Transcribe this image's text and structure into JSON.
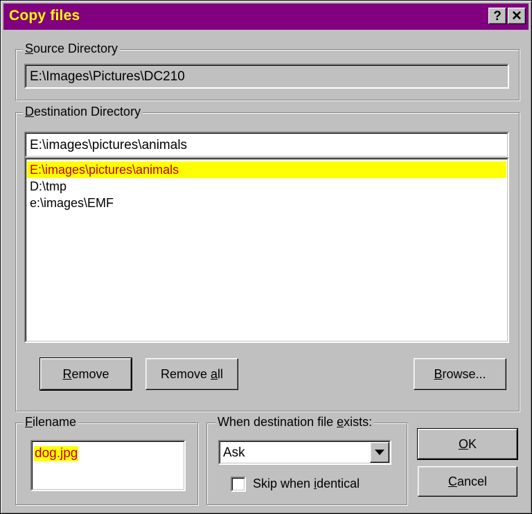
{
  "window": {
    "title": "Copy files",
    "help_label": "?",
    "close_label": "✕"
  },
  "source": {
    "group_label_accel": "S",
    "group_label_rest": "ource Directory",
    "path": "E:\\Images\\Pictures\\DC210"
  },
  "destination": {
    "group_label_accel": "D",
    "group_label_rest": "estination Directory",
    "path": "E:\\images\\pictures\\animals",
    "list": [
      {
        "label": "E:\\images\\pictures\\animals"
      },
      {
        "label": "D:\\tmp"
      },
      {
        "label": "e:\\images\\EMF"
      }
    ],
    "remove_accel": "R",
    "remove_rest": "emove",
    "remove_all_pre": "Remove ",
    "remove_all_accel": "a",
    "remove_all_post": "ll",
    "browse_accel": "B",
    "browse_rest": "rowse..."
  },
  "filename": {
    "group_label_accel": "F",
    "group_label_rest": "ilename",
    "value": "dog.jpg"
  },
  "exists": {
    "group_label_pre": "When destination file ",
    "group_label_accel": "e",
    "group_label_post": "xists:",
    "selected": "Ask",
    "skip_pre": "Skip when ",
    "skip_accel": "i",
    "skip_post": "dentical",
    "skip_checked": false
  },
  "buttons": {
    "ok_accel": "O",
    "ok_rest": "K",
    "cancel_accel": "C",
    "cancel_rest": "ancel"
  },
  "colors": {
    "title_bg": "#800080",
    "title_text": "#ffff00",
    "highlight_bg": "#ffff00",
    "highlight_text": "#c00000",
    "face": "#c0c0c0"
  }
}
